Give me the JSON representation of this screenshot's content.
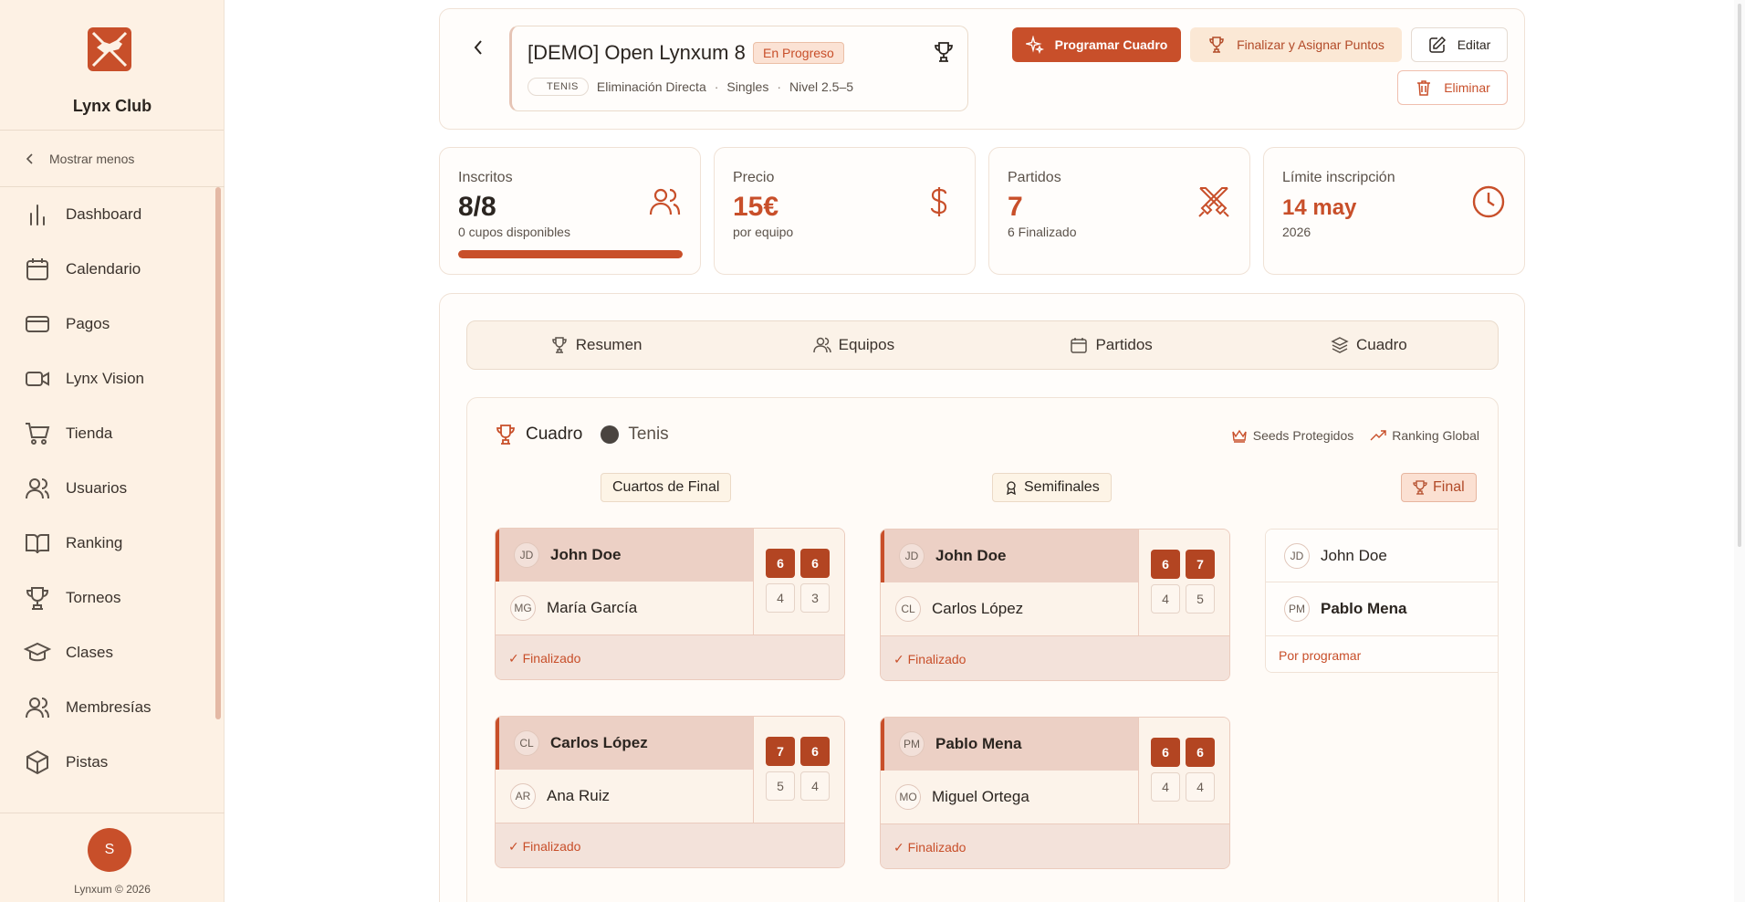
{
  "sidebar": {
    "brand": "Lynx Club",
    "collapse_label": "Mostrar menos",
    "items": [
      {
        "label": "Dashboard",
        "icon": "chart-bar-icon"
      },
      {
        "label": "Calendario",
        "icon": "calendar-icon"
      },
      {
        "label": "Pagos",
        "icon": "credit-card-icon"
      },
      {
        "label": "Lynx Vision",
        "icon": "video-icon"
      },
      {
        "label": "Tienda",
        "icon": "cart-icon"
      },
      {
        "label": "Usuarios",
        "icon": "users-icon"
      },
      {
        "label": "Ranking",
        "icon": "book-icon"
      },
      {
        "label": "Torneos",
        "icon": "trophy-icon"
      },
      {
        "label": "Clases",
        "icon": "graduation-cap-icon"
      },
      {
        "label": "Membresías",
        "icon": "users-icon"
      },
      {
        "label": "Pistas",
        "icon": "box-icon"
      }
    ],
    "user_initial": "S",
    "copyright": "Lynxum © 2026"
  },
  "header": {
    "title": "[DEMO] Open Lynxum 8",
    "status": "En Progreso",
    "sport": "TENIS",
    "format": "Eliminación Directa",
    "mode": "Singles",
    "level": "Nivel 2.5–5",
    "separator": "·",
    "actions": {
      "schedule": "Programar Cuadro",
      "finalize": "Finalizar y Asignar Puntos",
      "edit": "Editar",
      "delete": "Eliminar"
    }
  },
  "stats": {
    "enrolled": {
      "label": "Inscritos",
      "value": "8/8",
      "sub": "0 cupos disponibles",
      "fill_fraction": 1.0
    },
    "price": {
      "label": "Precio",
      "value": "15€",
      "sub": "por equipo"
    },
    "matches": {
      "label": "Partidos",
      "value": "7",
      "sub": "6 Finalizado"
    },
    "deadline": {
      "label": "Límite inscripción",
      "value": "14 may",
      "sub": "2026"
    }
  },
  "tabs": [
    {
      "label": "Resumen",
      "icon": "trophy-icon"
    },
    {
      "label": "Equipos",
      "icon": "users-icon"
    },
    {
      "label": "Partidos",
      "icon": "calendar-icon"
    },
    {
      "label": "Cuadro",
      "icon": "layers-icon"
    }
  ],
  "bracket": {
    "title": "Cuadro",
    "sport": "Tenis",
    "options": {
      "seeds": "Seeds Protegidos",
      "ranking": "Ranking Global"
    },
    "rounds": {
      "quarters": "Cuartos de Final",
      "semis": "Semifinales",
      "final": "Final"
    },
    "matches": [
      {
        "p1": {
          "initials": "JD",
          "name": "John Doe"
        },
        "p2": {
          "initials": "MG",
          "name": "María García"
        },
        "s1": [
          "6",
          "6"
        ],
        "s2": [
          "4",
          "3"
        ],
        "status": "✓ Finalizado"
      },
      {
        "p1": {
          "initials": "CL",
          "name": "Carlos López"
        },
        "p2": {
          "initials": "AR",
          "name": "Ana Ruiz"
        },
        "s1": [
          "7",
          "6"
        ],
        "s2": [
          "5",
          "4"
        ],
        "status": "✓ Finalizado"
      },
      {
        "p1": {
          "initials": "JD",
          "name": "John Doe"
        },
        "p2": {
          "initials": "CL",
          "name": "Carlos López"
        },
        "s1": [
          "6",
          "7"
        ],
        "s2": [
          "4",
          "5"
        ],
        "status": "✓ Finalizado"
      },
      {
        "p1": {
          "initials": "PM",
          "name": "Pablo Mena"
        },
        "p2": {
          "initials": "MO",
          "name": "Miguel Ortega"
        },
        "s1": [
          "6",
          "6"
        ],
        "s2": [
          "4",
          "4"
        ],
        "status": "✓ Finalizado"
      },
      {
        "p1": {
          "initials": "JD",
          "name": "John Doe"
        },
        "p2": {
          "initials": "PM",
          "name": "Pablo Mena"
        },
        "status": "Por programar"
      }
    ]
  },
  "colors": {
    "accent": "#c84f2a",
    "sidebar_bg": "#fdf1e4",
    "winner_score": "#b34522"
  }
}
